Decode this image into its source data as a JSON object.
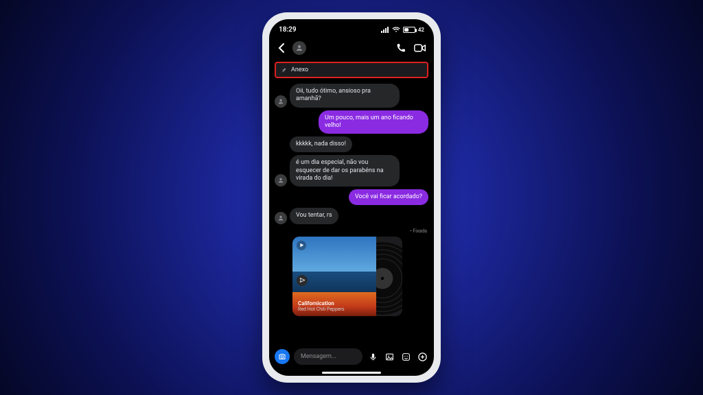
{
  "statusbar": {
    "time": "18:29",
    "battery_pct": "42"
  },
  "pinned": {
    "label": "Anexo"
  },
  "messages": [
    {
      "side": "in",
      "show_avatar": true,
      "text": "Oii, tudo ótimo, ansioso pra amanhã?"
    },
    {
      "side": "out",
      "show_avatar": false,
      "text": "Um pouco, mais um ano ficando velho!"
    },
    {
      "side": "in",
      "show_avatar": false,
      "text": "kkkkk, nada disso!"
    },
    {
      "side": "in",
      "show_avatar": true,
      "text": "é um dia especial, não vou esquecer de dar os parabéns na virada do dia!"
    },
    {
      "side": "out",
      "show_avatar": false,
      "text": "Você vai ficar acordado?"
    },
    {
      "side": "in",
      "show_avatar": true,
      "text": "Vou tentar, rs"
    }
  ],
  "media": {
    "pinned_label": "• Fixada",
    "title": "Californication",
    "artist": "Red Hot Chili Peppers"
  },
  "composer": {
    "placeholder": "Mensagem..."
  }
}
